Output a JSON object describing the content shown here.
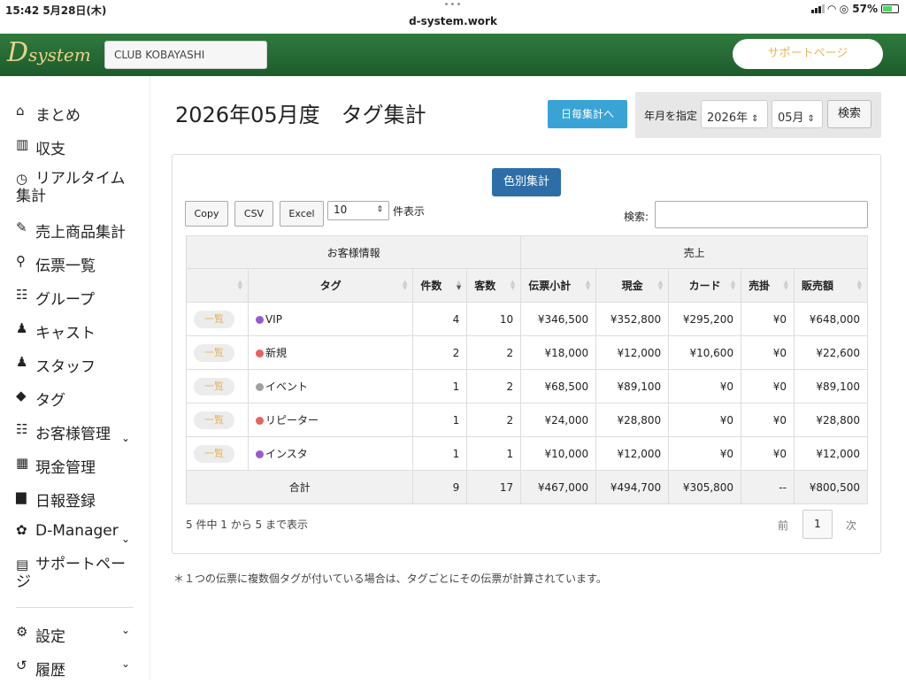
{
  "status_bar": {
    "time": "15:42 5月28日(木)",
    "url": "d-system.work",
    "battery": "57%"
  },
  "header": {
    "logo_main": "D",
    "logo_rest": "system",
    "club_name": "CLUB KOBAYASHI",
    "support_label": "サポートページ"
  },
  "sidebar": {
    "items": [
      {
        "icon": "home-icon",
        "glyph": "⌂",
        "label": "まとめ"
      },
      {
        "icon": "chart-icon",
        "glyph": "▥",
        "label": "収支"
      },
      {
        "icon": "clock-icon",
        "glyph": "◷",
        "label": "リアルタイム集計"
      },
      {
        "icon": "tag-stroke-icon",
        "glyph": "✎",
        "label": "売上商品集計"
      },
      {
        "icon": "search-icon",
        "glyph": "⚲",
        "label": "伝票一覧"
      },
      {
        "icon": "group-icon",
        "glyph": "☷",
        "label": "グループ"
      },
      {
        "icon": "person-icon",
        "glyph": "♟",
        "label": "キャスト"
      },
      {
        "icon": "person-icon",
        "glyph": "♟",
        "label": "スタッフ"
      },
      {
        "icon": "tags-icon",
        "glyph": "◆",
        "label": "タグ"
      },
      {
        "icon": "users-icon",
        "glyph": "☷",
        "label": "お客様管理"
      },
      {
        "icon": "calculator-icon",
        "glyph": "▦",
        "label": "現金管理"
      },
      {
        "icon": "calendar-icon",
        "glyph": "▆",
        "label": "日報登録"
      },
      {
        "icon": "gear-icon",
        "glyph": "✿",
        "label": "D-Manager"
      },
      {
        "icon": "file-icon",
        "glyph": "▤",
        "label": "サポートページ"
      }
    ],
    "settings_label": "設定",
    "history_label": "履歴"
  },
  "main": {
    "title": "2026年05月度　タグ集計",
    "daily_button": "日毎集計へ",
    "ym_label": "年月を指定",
    "year_value": "2026年",
    "month_value": "05月",
    "search_button": "検索",
    "color_button": "色別集計",
    "export_buttons": [
      "Copy",
      "CSV",
      "Excel"
    ],
    "page_length": "10",
    "page_length_suffix": "件表示",
    "search_label": "検索:",
    "group_headers": [
      "お客様情報",
      "売上"
    ],
    "columns": [
      "タグ",
      "件数",
      "客数",
      "伝票小計",
      "現金",
      "カード",
      "売掛",
      "販売額"
    ],
    "list_button_label": "一覧",
    "rows": [
      {
        "tag": "VIP",
        "color": "#9b59d0",
        "count": "4",
        "customers": "10",
        "subtotal": "¥346,500",
        "cash": "¥352,800",
        "card": "¥295,200",
        "credit": "¥0",
        "sales": "¥648,000"
      },
      {
        "tag": "新規",
        "color": "#e86060",
        "count": "2",
        "customers": "2",
        "subtotal": "¥18,000",
        "cash": "¥12,000",
        "card": "¥10,600",
        "credit": "¥0",
        "sales": "¥22,600"
      },
      {
        "tag": "イベント",
        "color": "#a0a0a0",
        "count": "1",
        "customers": "2",
        "subtotal": "¥68,500",
        "cash": "¥89,100",
        "card": "¥0",
        "credit": "¥0",
        "sales": "¥89,100"
      },
      {
        "tag": "リピーター",
        "color": "#e86060",
        "count": "1",
        "customers": "2",
        "subtotal": "¥24,000",
        "cash": "¥28,800",
        "card": "¥0",
        "credit": "¥0",
        "sales": "¥28,800"
      },
      {
        "tag": "インスタ",
        "color": "#9b59d0",
        "count": "1",
        "customers": "1",
        "subtotal": "¥10,000",
        "cash": "¥12,000",
        "card": "¥0",
        "credit": "¥0",
        "sales": "¥12,000"
      }
    ],
    "total": {
      "label": "合計",
      "count": "9",
      "customers": "17",
      "subtotal": "¥467,000",
      "cash": "¥494,700",
      "card": "¥305,800",
      "credit": "--",
      "sales": "¥800,500"
    },
    "info": "5 件中 1 から 5 まで表示",
    "prev": "前",
    "page": "1",
    "next": "次",
    "note": "＊１つの伝票に複数個タグが付いている場合は、タグごとにその伝票が計算されています。"
  }
}
